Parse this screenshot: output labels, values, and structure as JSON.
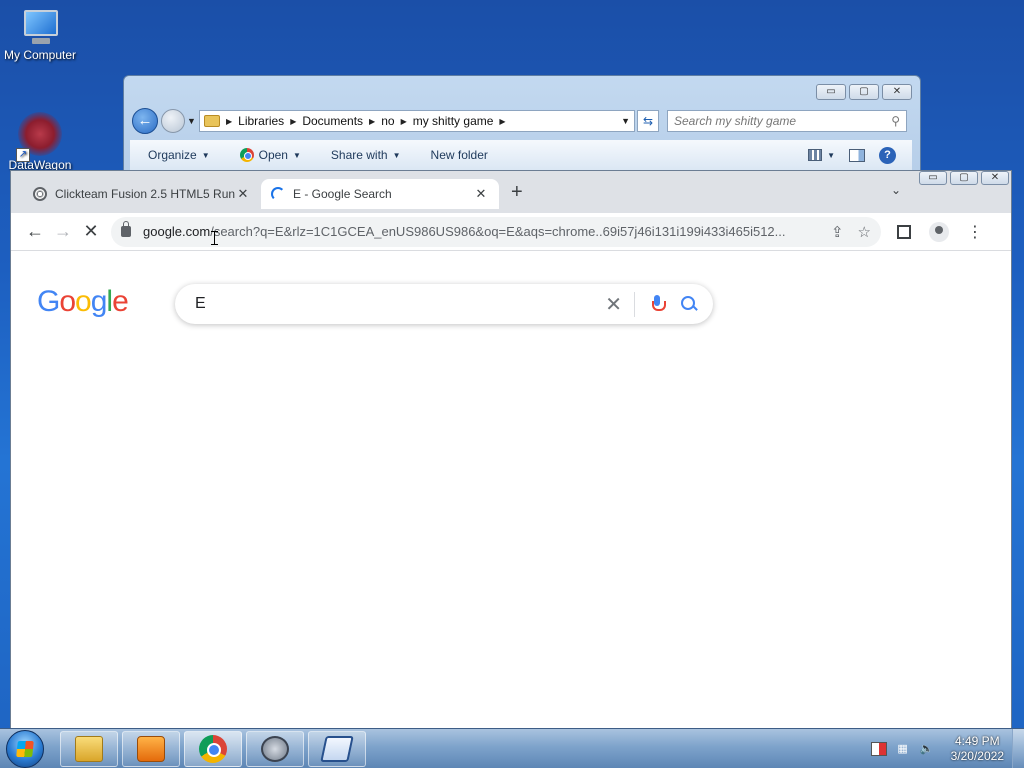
{
  "desktop": {
    "icons": [
      {
        "label": "My Computer",
        "icon": "monitor-icon"
      },
      {
        "label": "DataWagon",
        "icon": "datawagon-icon"
      }
    ]
  },
  "explorer": {
    "controls": {
      "minimize": "▭",
      "maximize": "▢",
      "close": "✕"
    },
    "breadcrumb": [
      "Libraries",
      "Documents",
      "no",
      "my shitty game"
    ],
    "search_placeholder": "Search my shitty game",
    "toolbar": {
      "organize": "Organize",
      "open": "Open",
      "share_with": "Share with",
      "new_folder": "New folder"
    }
  },
  "browser": {
    "controls": {
      "minimize": "▭",
      "maximize": "▢",
      "close": "✕"
    },
    "tabs": [
      {
        "title": "Clickteam Fusion 2.5 HTML5 Run",
        "icon": "globe-icon"
      },
      {
        "title": "E - Google Search",
        "icon": "loading-spinner-icon",
        "active": true
      }
    ],
    "url": {
      "host": "google.com",
      "path": "/search?q=E&rlz=1C1GCEA_enUS986US986&oq=E&aqs=chrome..69i57j46i131i199i433i465i512..."
    },
    "page": {
      "logo_letters": [
        "G",
        "o",
        "o",
        "g",
        "l",
        "e"
      ],
      "query": "E"
    }
  },
  "taskbar": {
    "apps": [
      "folder-icon",
      "media-player-icon",
      "chrome-icon",
      "compass-icon",
      "app-window-icon"
    ],
    "clock": {
      "time": "4:49 PM",
      "date": "3/20/2022"
    }
  }
}
